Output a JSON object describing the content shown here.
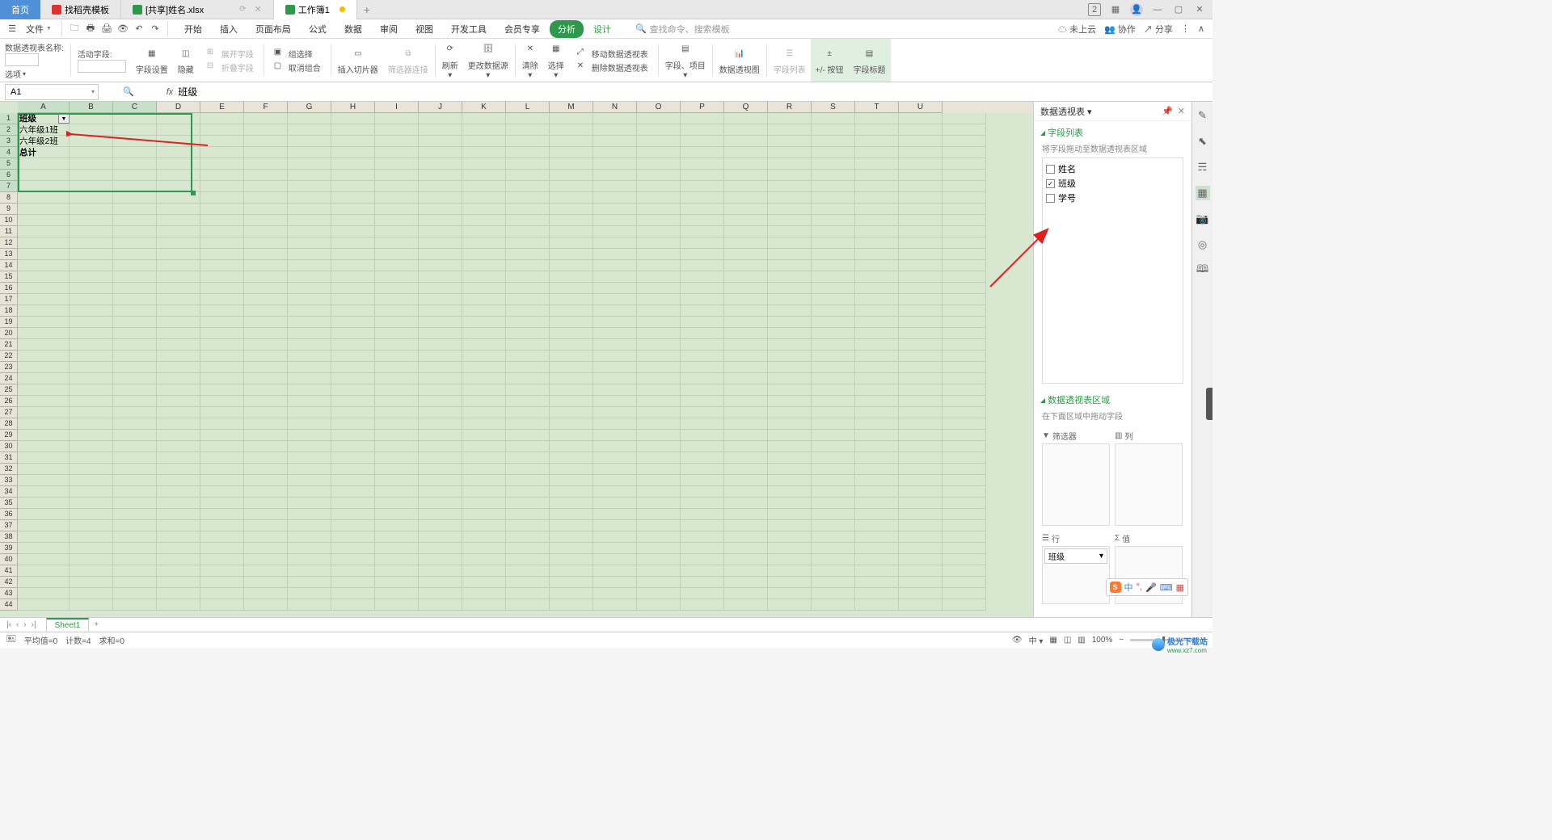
{
  "titlebar": {
    "home": "首页",
    "tab1": "找稻壳模板",
    "tab2": "[共享]姓名.xlsx",
    "tab3": "工作簿1",
    "right_badge": "2"
  },
  "menubar": {
    "file": "文件",
    "tabs": [
      "开始",
      "插入",
      "页面布局",
      "公式",
      "数据",
      "审阅",
      "视图",
      "开发工具",
      "会员专享",
      "分析",
      "设计"
    ],
    "search_placeholder": "查找命令、搜索模板",
    "cloud": "未上云",
    "coop": "协作",
    "share": "分享"
  },
  "ribbon": {
    "name_label": "数据透视表名称:",
    "options": "选项",
    "active_field": "活动字段:",
    "field_settings": "字段设置",
    "hide": "隐藏",
    "expand": "展开字段",
    "collapse": "折叠字段",
    "group_sel": "组选择",
    "ungroup": "取消组合",
    "insert_slicer": "插入切片器",
    "connections": "筛选器连接",
    "refresh": "刷新",
    "change_source": "更改数据源",
    "clear": "清除",
    "select": "选择",
    "move_pivot": "移动数据透视表",
    "delete_pivot": "删除数据透视表",
    "fields_items": "字段、项目",
    "pivot_chart": "数据透视图",
    "field_list": "字段列表",
    "pm_button": "+/- 按钮",
    "field_headers": "字段标题"
  },
  "cellref": {
    "ref": "A1",
    "fx": "fx",
    "value": "班级"
  },
  "columns": [
    "A",
    "B",
    "C",
    "D",
    "E",
    "F",
    "G",
    "H",
    "I",
    "J",
    "K",
    "L",
    "M",
    "N",
    "O",
    "P",
    "Q",
    "R",
    "S",
    "T",
    "U"
  ],
  "cells": {
    "a1": "班级",
    "a2": "六年级1班",
    "a3": "六年级2班",
    "a4": "总计"
  },
  "pivot_panel": {
    "title": "数据透视表",
    "section1": "字段列表",
    "hint1": "将字段拖动至数据透视表区域",
    "fields": [
      {
        "label": "姓名",
        "checked": false
      },
      {
        "label": "班级",
        "checked": true
      },
      {
        "label": "学号",
        "checked": false
      }
    ],
    "section2": "数据透视表区域",
    "hint2": "在下面区域中拖动字段",
    "filter": "筛选器",
    "col": "列",
    "row": "行",
    "val": "值",
    "row_item": "班级"
  },
  "sheet_tabs": {
    "sheet1": "Sheet1"
  },
  "status": {
    "avg": "平均值=0",
    "count": "计数=4",
    "sum": "求和=0",
    "zoom": "100%"
  },
  "ime": {
    "lang": "中"
  },
  "watermark": {
    "name": "极光下载站",
    "url": "www.xz7.com"
  }
}
